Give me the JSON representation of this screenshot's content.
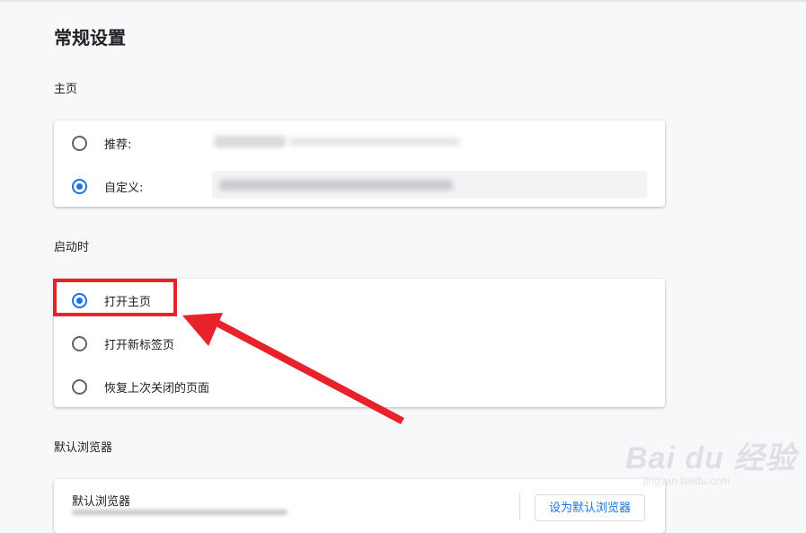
{
  "page": {
    "title": "常规设置"
  },
  "homepage": {
    "label": "主页",
    "options": [
      {
        "label": "推荐:",
        "checked": false
      },
      {
        "label": "自定义:",
        "checked": true
      }
    ]
  },
  "startup": {
    "label": "启动时",
    "options": [
      {
        "label": "打开主页",
        "checked": true
      },
      {
        "label": "打开新标签页",
        "checked": false
      },
      {
        "label": "恢复上次关闭的页面",
        "checked": false
      }
    ]
  },
  "default_browser": {
    "label": "默认浏览器",
    "title": "默认浏览器",
    "button": "设为默认浏览器"
  },
  "annotation": {
    "color": "#e8222a"
  },
  "colors": {
    "accent": "#1a73e8",
    "background": "#f7f8fa"
  },
  "watermark": {
    "brand": "Bai du 经验",
    "url": "jingyan.baidu.com"
  }
}
